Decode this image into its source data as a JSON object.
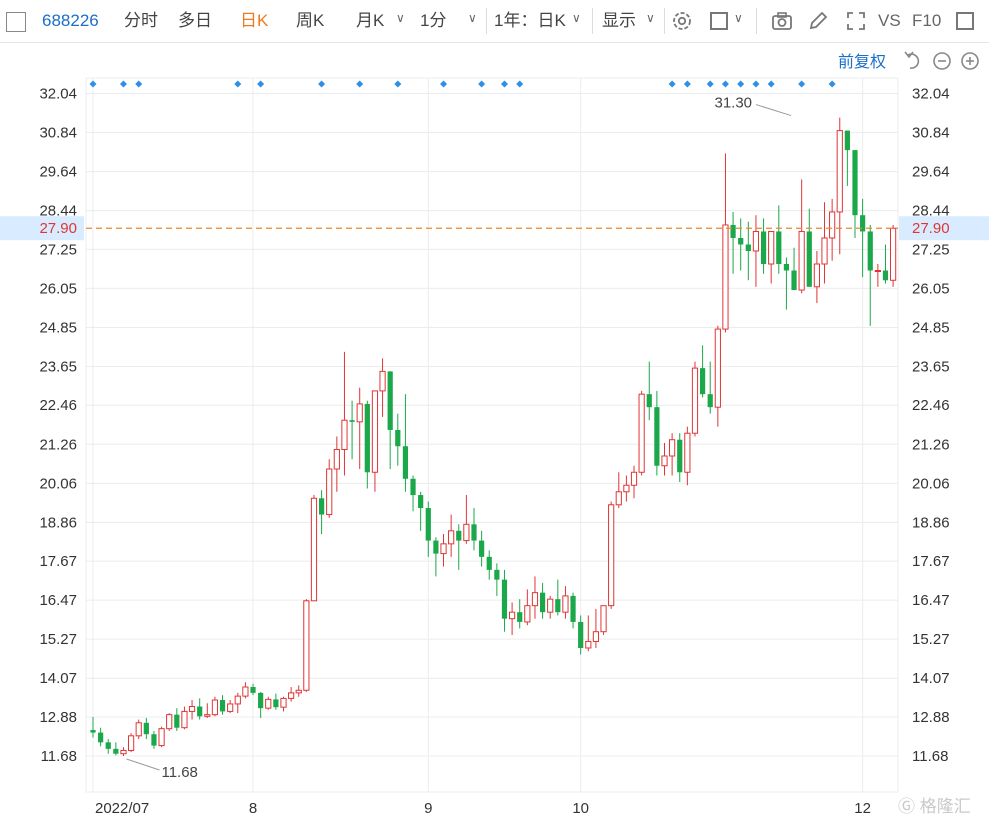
{
  "toolbar": {
    "code": "688226",
    "items": [
      "分时",
      "多日",
      "日K",
      "周K",
      "月K",
      "1分",
      "1年：日K",
      "显示"
    ],
    "active_item": "日K",
    "vs_label": "VS",
    "f10_label": "F10"
  },
  "price_mode": "前复权",
  "colors": {
    "up": "#e03535",
    "down": "#1aa84a",
    "accent": "#f07a1e",
    "current": "#e8892b",
    "grid": "#ececec",
    "text": "#333333"
  },
  "current_price": "27.90",
  "watermark": "格隆汇",
  "chart_data": {
    "type": "candlestick",
    "title": "",
    "xlabel": "",
    "ylabel": "",
    "ylim": [
      11.1,
      32.6
    ],
    "y_ticks": [
      "32.04",
      "30.84",
      "29.64",
      "28.44",
      "27.25",
      "26.05",
      "24.85",
      "23.65",
      "22.46",
      "21.26",
      "20.06",
      "18.86",
      "17.67",
      "16.47",
      "15.27",
      "14.07",
      "12.88",
      "11.68"
    ],
    "x_labels": [
      {
        "label": "2022/07",
        "index": 0
      },
      {
        "label": "8",
        "index": 21
      },
      {
        "label": "9",
        "index": 44
      },
      {
        "label": "10",
        "index": 64
      },
      {
        "label": "12",
        "index": 101
      }
    ],
    "max_annotation": {
      "label": "31.30",
      "index": 92,
      "value": 31.3
    },
    "min_annotation": {
      "label": "11.68",
      "index": 4,
      "value": 11.68
    },
    "current_line": {
      "label": "27.90",
      "value": 27.9
    },
    "event_marker_indices": [
      0,
      4,
      6,
      19,
      22,
      30,
      35,
      40,
      46,
      51,
      54,
      56,
      76,
      78,
      81,
      83,
      85,
      87,
      89,
      93,
      97
    ],
    "series": [
      {
        "name": "",
        "fields": [
          "open",
          "high",
          "low",
          "close"
        ],
        "candles": [
          [
            12.48,
            12.88,
            12.25,
            12.4
          ],
          [
            12.4,
            12.55,
            11.98,
            12.1
          ],
          [
            12.1,
            12.2,
            11.75,
            11.9
          ],
          [
            11.9,
            12.1,
            11.7,
            11.75
          ],
          [
            11.75,
            11.95,
            11.68,
            11.85
          ],
          [
            11.85,
            12.38,
            11.8,
            12.3
          ],
          [
            12.3,
            12.8,
            12.2,
            12.7
          ],
          [
            12.7,
            12.85,
            12.2,
            12.35
          ],
          [
            12.35,
            12.45,
            11.9,
            12.0
          ],
          [
            12.0,
            12.58,
            11.95,
            12.52
          ],
          [
            12.52,
            13.0,
            12.45,
            12.95
          ],
          [
            12.95,
            13.15,
            12.45,
            12.55
          ],
          [
            12.55,
            13.2,
            12.5,
            13.05
          ],
          [
            13.05,
            13.4,
            12.8,
            13.2
          ],
          [
            13.2,
            13.45,
            12.8,
            12.9
          ],
          [
            12.9,
            13.3,
            12.85,
            12.95
          ],
          [
            12.95,
            13.5,
            12.9,
            13.4
          ],
          [
            13.4,
            13.55,
            12.95,
            13.05
          ],
          [
            13.05,
            13.4,
            13.0,
            13.28
          ],
          [
            13.28,
            13.62,
            13.0,
            13.52
          ],
          [
            13.52,
            13.95,
            13.45,
            13.8
          ],
          [
            13.8,
            13.9,
            13.55,
            13.62
          ],
          [
            13.62,
            13.65,
            12.85,
            13.15
          ],
          [
            13.15,
            13.5,
            13.1,
            13.42
          ],
          [
            13.42,
            13.6,
            13.1,
            13.18
          ],
          [
            13.18,
            13.5,
            13.05,
            13.45
          ],
          [
            13.45,
            13.8,
            13.35,
            13.62
          ],
          [
            13.62,
            13.85,
            13.5,
            13.7
          ],
          [
            13.7,
            16.5,
            13.65,
            16.45
          ],
          [
            16.45,
            19.7,
            17.1,
            19.6
          ],
          [
            19.6,
            19.85,
            18.5,
            19.1
          ],
          [
            19.1,
            20.8,
            19.0,
            20.5
          ],
          [
            20.5,
            21.5,
            19.8,
            21.1
          ],
          [
            21.1,
            24.1,
            20.3,
            22.0
          ],
          [
            22.0,
            22.6,
            20.8,
            21.95
          ],
          [
            21.95,
            23.0,
            20.5,
            22.5
          ],
          [
            22.5,
            22.6,
            19.9,
            20.4
          ],
          [
            20.4,
            22.7,
            19.8,
            22.9
          ],
          [
            22.9,
            23.9,
            22.1,
            23.5
          ],
          [
            23.5,
            23.5,
            20.5,
            21.7
          ],
          [
            21.7,
            22.2,
            20.6,
            21.2
          ],
          [
            21.2,
            22.8,
            19.8,
            20.2
          ],
          [
            20.2,
            20.3,
            19.2,
            19.7
          ],
          [
            19.7,
            19.8,
            18.6,
            19.3
          ],
          [
            19.3,
            19.5,
            17.8,
            18.3
          ],
          [
            18.3,
            18.4,
            17.2,
            17.9
          ],
          [
            17.9,
            18.5,
            17.5,
            18.2
          ],
          [
            18.2,
            19.1,
            17.8,
            18.6
          ],
          [
            18.6,
            18.8,
            17.4,
            18.3
          ],
          [
            18.3,
            19.7,
            18.2,
            18.8
          ],
          [
            18.8,
            19.3,
            18.0,
            18.3
          ],
          [
            18.3,
            18.6,
            17.5,
            17.8
          ],
          [
            17.8,
            18.0,
            17.1,
            17.4
          ],
          [
            17.4,
            17.6,
            16.6,
            17.1
          ],
          [
            17.1,
            17.4,
            15.5,
            15.9
          ],
          [
            15.9,
            16.4,
            15.4,
            16.1
          ],
          [
            16.1,
            16.5,
            15.6,
            15.8
          ],
          [
            15.8,
            16.8,
            15.7,
            16.3
          ],
          [
            16.3,
            17.2,
            15.9,
            16.7
          ],
          [
            16.7,
            17.0,
            15.9,
            16.1
          ],
          [
            16.1,
            16.6,
            15.9,
            16.5
          ],
          [
            16.5,
            17.1,
            16.0,
            16.1
          ],
          [
            16.1,
            16.9,
            15.9,
            16.6
          ],
          [
            16.6,
            16.7,
            15.6,
            15.8
          ],
          [
            15.8,
            16.0,
            14.8,
            15.0
          ],
          [
            15.0,
            16.0,
            14.9,
            15.2
          ],
          [
            15.2,
            16.2,
            15.0,
            15.5
          ],
          [
            15.5,
            16.3,
            15.4,
            16.3
          ],
          [
            16.3,
            19.5,
            16.2,
            19.4
          ],
          [
            19.4,
            20.4,
            19.3,
            19.8
          ],
          [
            19.8,
            20.3,
            19.5,
            20.0
          ],
          [
            20.0,
            20.6,
            19.6,
            20.4
          ],
          [
            20.4,
            22.9,
            20.3,
            22.8
          ],
          [
            22.8,
            23.8,
            22.0,
            22.4
          ],
          [
            22.4,
            22.9,
            20.3,
            20.6
          ],
          [
            20.6,
            21.3,
            20.3,
            20.9
          ],
          [
            20.9,
            21.6,
            20.3,
            21.4
          ],
          [
            21.4,
            21.6,
            20.1,
            20.4
          ],
          [
            20.4,
            21.8,
            20.0,
            21.6
          ],
          [
            21.6,
            23.8,
            21.5,
            23.6
          ],
          [
            23.6,
            24.3,
            22.7,
            22.8
          ],
          [
            22.8,
            23.8,
            22.2,
            22.4
          ],
          [
            22.4,
            24.9,
            21.8,
            24.8
          ],
          [
            24.8,
            30.2,
            24.7,
            28.0
          ],
          [
            28.0,
            28.4,
            26.5,
            27.6
          ],
          [
            27.6,
            28.2,
            26.6,
            27.4
          ],
          [
            27.4,
            28.1,
            26.3,
            27.2
          ],
          [
            27.2,
            28.3,
            26.1,
            27.8
          ],
          [
            27.8,
            28.2,
            26.5,
            26.8
          ],
          [
            26.8,
            27.2,
            26.2,
            27.8
          ],
          [
            27.8,
            28.6,
            26.5,
            26.8
          ],
          [
            26.8,
            27.0,
            25.4,
            26.6
          ],
          [
            26.6,
            27.3,
            26.1,
            26.0
          ],
          [
            26.0,
            29.4,
            25.9,
            27.8
          ],
          [
            27.8,
            28.5,
            26.1,
            26.1
          ],
          [
            26.1,
            27.2,
            25.6,
            26.8
          ],
          [
            26.8,
            28.7,
            26.2,
            27.6
          ],
          [
            27.6,
            28.8,
            26.9,
            28.4
          ],
          [
            28.4,
            31.3,
            27.1,
            30.9
          ],
          [
            30.9,
            30.4,
            29.2,
            30.3
          ],
          [
            30.3,
            30.1,
            27.6,
            28.3
          ],
          [
            28.3,
            28.8,
            26.4,
            27.8
          ],
          [
            27.8,
            28.0,
            24.9,
            26.6
          ],
          [
            26.6,
            26.8,
            26.1,
            26.6
          ],
          [
            26.6,
            27.4,
            26.2,
            26.3
          ],
          [
            26.3,
            28.0,
            26.1,
            27.9
          ]
        ]
      }
    ]
  }
}
